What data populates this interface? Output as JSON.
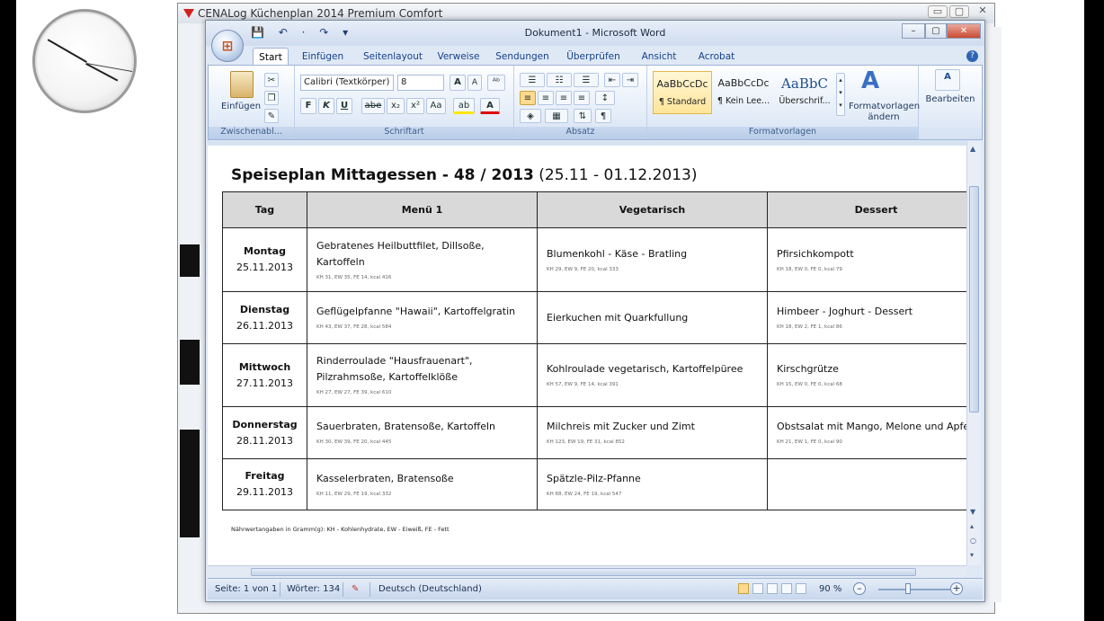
{
  "background_window": {
    "title": "CENALog Küchenplan 2014 Premium Comfort",
    "controls": [
      "▭",
      "▢",
      "✕"
    ]
  },
  "word": {
    "title": "Dokument1 - Microsoft Word",
    "qat": "💾 ↶ · ↷ ▾",
    "controls": {
      "minimize": "–",
      "maximize": "▢",
      "close": "✕"
    },
    "tabs": [
      "Start",
      "Einfügen",
      "Seitenlayout",
      "Verweise",
      "Sendungen",
      "Überprüfen",
      "Ansicht",
      "Acrobat"
    ],
    "active_tab": "Start",
    "help": "?",
    "ribbon": {
      "clipboard": {
        "label": "Zwischenabl...",
        "paste": "Einfügen"
      },
      "font": {
        "label": "Schriftart",
        "font_name": "Calibri (Textkörper)",
        "font_size": "8",
        "grow": "A",
        "shrink": "A",
        "clear": "ᴬᵇ",
        "bold": "F",
        "italic": "K",
        "underline": "U",
        "strike": "abe",
        "subscript": "x₂",
        "superscript": "x²",
        "case": "Aa",
        "highlight": "ab",
        "color": "A"
      },
      "paragraph": {
        "label": "Absatz"
      },
      "styles": {
        "label": "Formatvorlagen",
        "items": [
          {
            "preview": "AaBbCcDc",
            "name": "¶ Standard"
          },
          {
            "preview": "AaBbCcDc",
            "name": "¶ Kein Lee..."
          },
          {
            "preview": "AaBbC",
            "name": "Überschrif..."
          }
        ],
        "change": "Formatvorlagen ändern",
        "change_icon": "A"
      },
      "editing": {
        "label": "Bearbeiten",
        "icon": "A"
      }
    },
    "document": {
      "title_bold": "Speiseplan Mittagessen - 48 / 2013",
      "title_rest": " (25.11 - 01.12.2013)",
      "columns": [
        "Tag",
        "Menü 1",
        "Vegetarisch",
        "Dessert"
      ],
      "rows": [
        {
          "day": "Montag",
          "date": "25.11.2013",
          "menu": "Gebratenes Heilbuttfilet, Dillsoße, Kartoffeln",
          "menu_nut": "KH 31, EW 35, FE 14, kcal 416",
          "veg": "Blumenkohl - Käse - Bratling",
          "veg_nut": "KH 29, EW 9, FE 20, kcal 333",
          "dessert": "Pfirsichkompott",
          "dessert_nut": "KH 18, EW 0, FE 0, kcal 79"
        },
        {
          "day": "Dienstag",
          "date": "26.11.2013",
          "menu": "Geflügelpfanne \"Hawaii\", Kartoffelgratin",
          "menu_nut": "KH 43, EW 37, FE 28, kcal 584",
          "veg": "Eierkuchen mit Quarkfullung",
          "veg_nut": "",
          "dessert": "Himbeer - Joghurt - Dessert",
          "dessert_nut": "KH 18, EW 2, FE 1, kcal 86"
        },
        {
          "day": "Mittwoch",
          "date": "27.11.2013",
          "menu": "Rinderroulade \"Hausfrauenart\", Pilzrahmsoße, Kartoffelklöße",
          "menu_nut": "KH 27, EW 27, FE 39, kcal 610",
          "veg": "Kohlroulade vegetarisch, Kartoffelpüree",
          "veg_nut": "KH 57, EW 9, FE 14, kcal 391",
          "dessert": "Kirschgrütze",
          "dessert_nut": "KH 15, EW 0, FE 0, kcal 68"
        },
        {
          "day": "Donnerstag",
          "date": "28.11.2013",
          "menu": "Sauerbraten, Bratensoße, Kartoffeln",
          "menu_nut": "KH 30, EW 39, FE 20, kcal 445",
          "veg": "Milchreis mit Zucker und Zimt",
          "veg_nut": "KH 123, EW 19, FE 31, kcal 852",
          "dessert": "Obstsalat mit Mango, Melone und Apfe",
          "dessert_nut": "KH 21, EW 1, FE 0, kcal 90"
        },
        {
          "day": "Freitag",
          "date": "29.11.2013",
          "menu": "Kasselerbraten, Bratensoße",
          "menu_nut": "KH 11, EW 29, FE 19, kcal 332",
          "veg": "Spätzle-Pilz-Pfanne",
          "veg_nut": "KH 68, EW 24, FE 19, kcal 547",
          "dessert": "",
          "dessert_nut": ""
        }
      ],
      "footnote": "Nährwertangaben in Gramm(g): KH - Kohlenhydrate, EW - Eiweiß, FE - Fett"
    },
    "status": {
      "page": "Seite: 1 von 1",
      "words": "Wörter: 134",
      "language": "Deutsch (Deutschland)",
      "zoom": "90 %",
      "zoom_out": "–",
      "zoom_in": "+"
    }
  }
}
